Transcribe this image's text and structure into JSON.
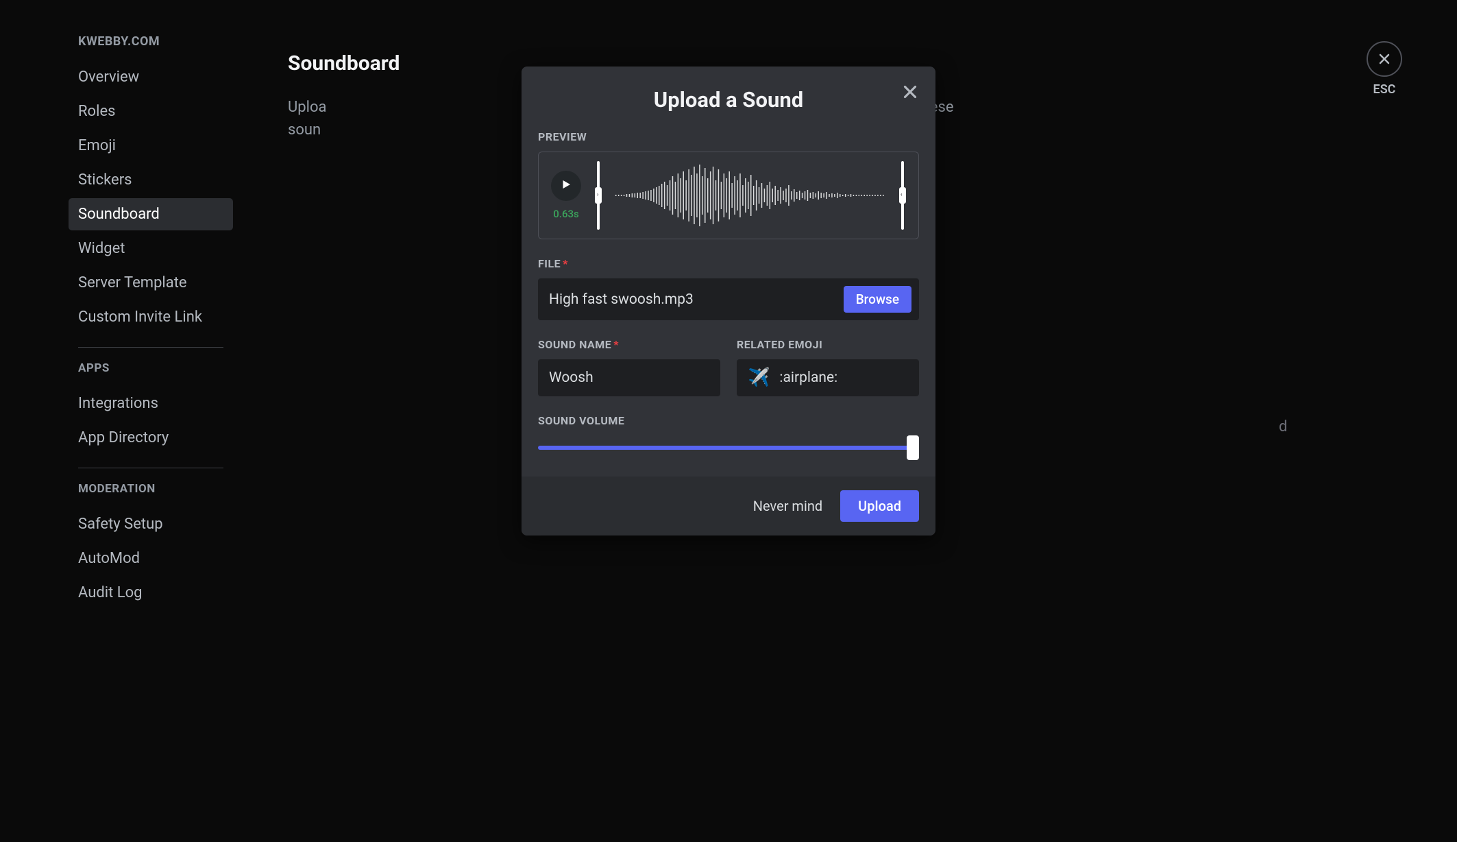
{
  "sidebar": {
    "server_name": "KWEBBY.COM",
    "items_main": [
      {
        "label": "Overview",
        "active": false
      },
      {
        "label": "Roles",
        "active": false
      },
      {
        "label": "Emoji",
        "active": false
      },
      {
        "label": "Stickers",
        "active": false
      },
      {
        "label": "Soundboard",
        "active": true
      },
      {
        "label": "Widget",
        "active": false
      },
      {
        "label": "Server Template",
        "active": false
      },
      {
        "label": "Custom Invite Link",
        "active": false
      }
    ],
    "section_apps_label": "APPS",
    "items_apps": [
      {
        "label": "Integrations"
      },
      {
        "label": "App Directory"
      }
    ],
    "section_moderation_label": "MODERATION",
    "items_moderation": [
      {
        "label": "Safety Setup"
      },
      {
        "label": "AutoMod"
      },
      {
        "label": "Audit Log"
      }
    ]
  },
  "page": {
    "title": "Soundboard",
    "description_partial_left": "Uploa",
    "description_partial_right": "ers will be able to access these",
    "description_partial_bottom": "soun",
    "bg_right_text": "d"
  },
  "close": {
    "esc_label": "ESC"
  },
  "modal": {
    "title": "Upload a Sound",
    "preview_label": "PREVIEW",
    "duration": "0.63s",
    "file_label": "FILE",
    "file_name": "High fast swoosh.mp3",
    "browse_label": "Browse",
    "sound_name_label": "SOUND NAME",
    "sound_name_value": "Woosh",
    "related_emoji_label": "RELATED EMOJI",
    "emoji_glyph": "✈️",
    "emoji_code": ":airplane:",
    "sound_volume_label": "SOUND VOLUME",
    "volume_percent": 100,
    "cancel_label": "Never mind",
    "upload_label": "Upload",
    "required_marker": "*",
    "colors": {
      "accent": "#5865f2",
      "success": "#3ba55c"
    }
  }
}
